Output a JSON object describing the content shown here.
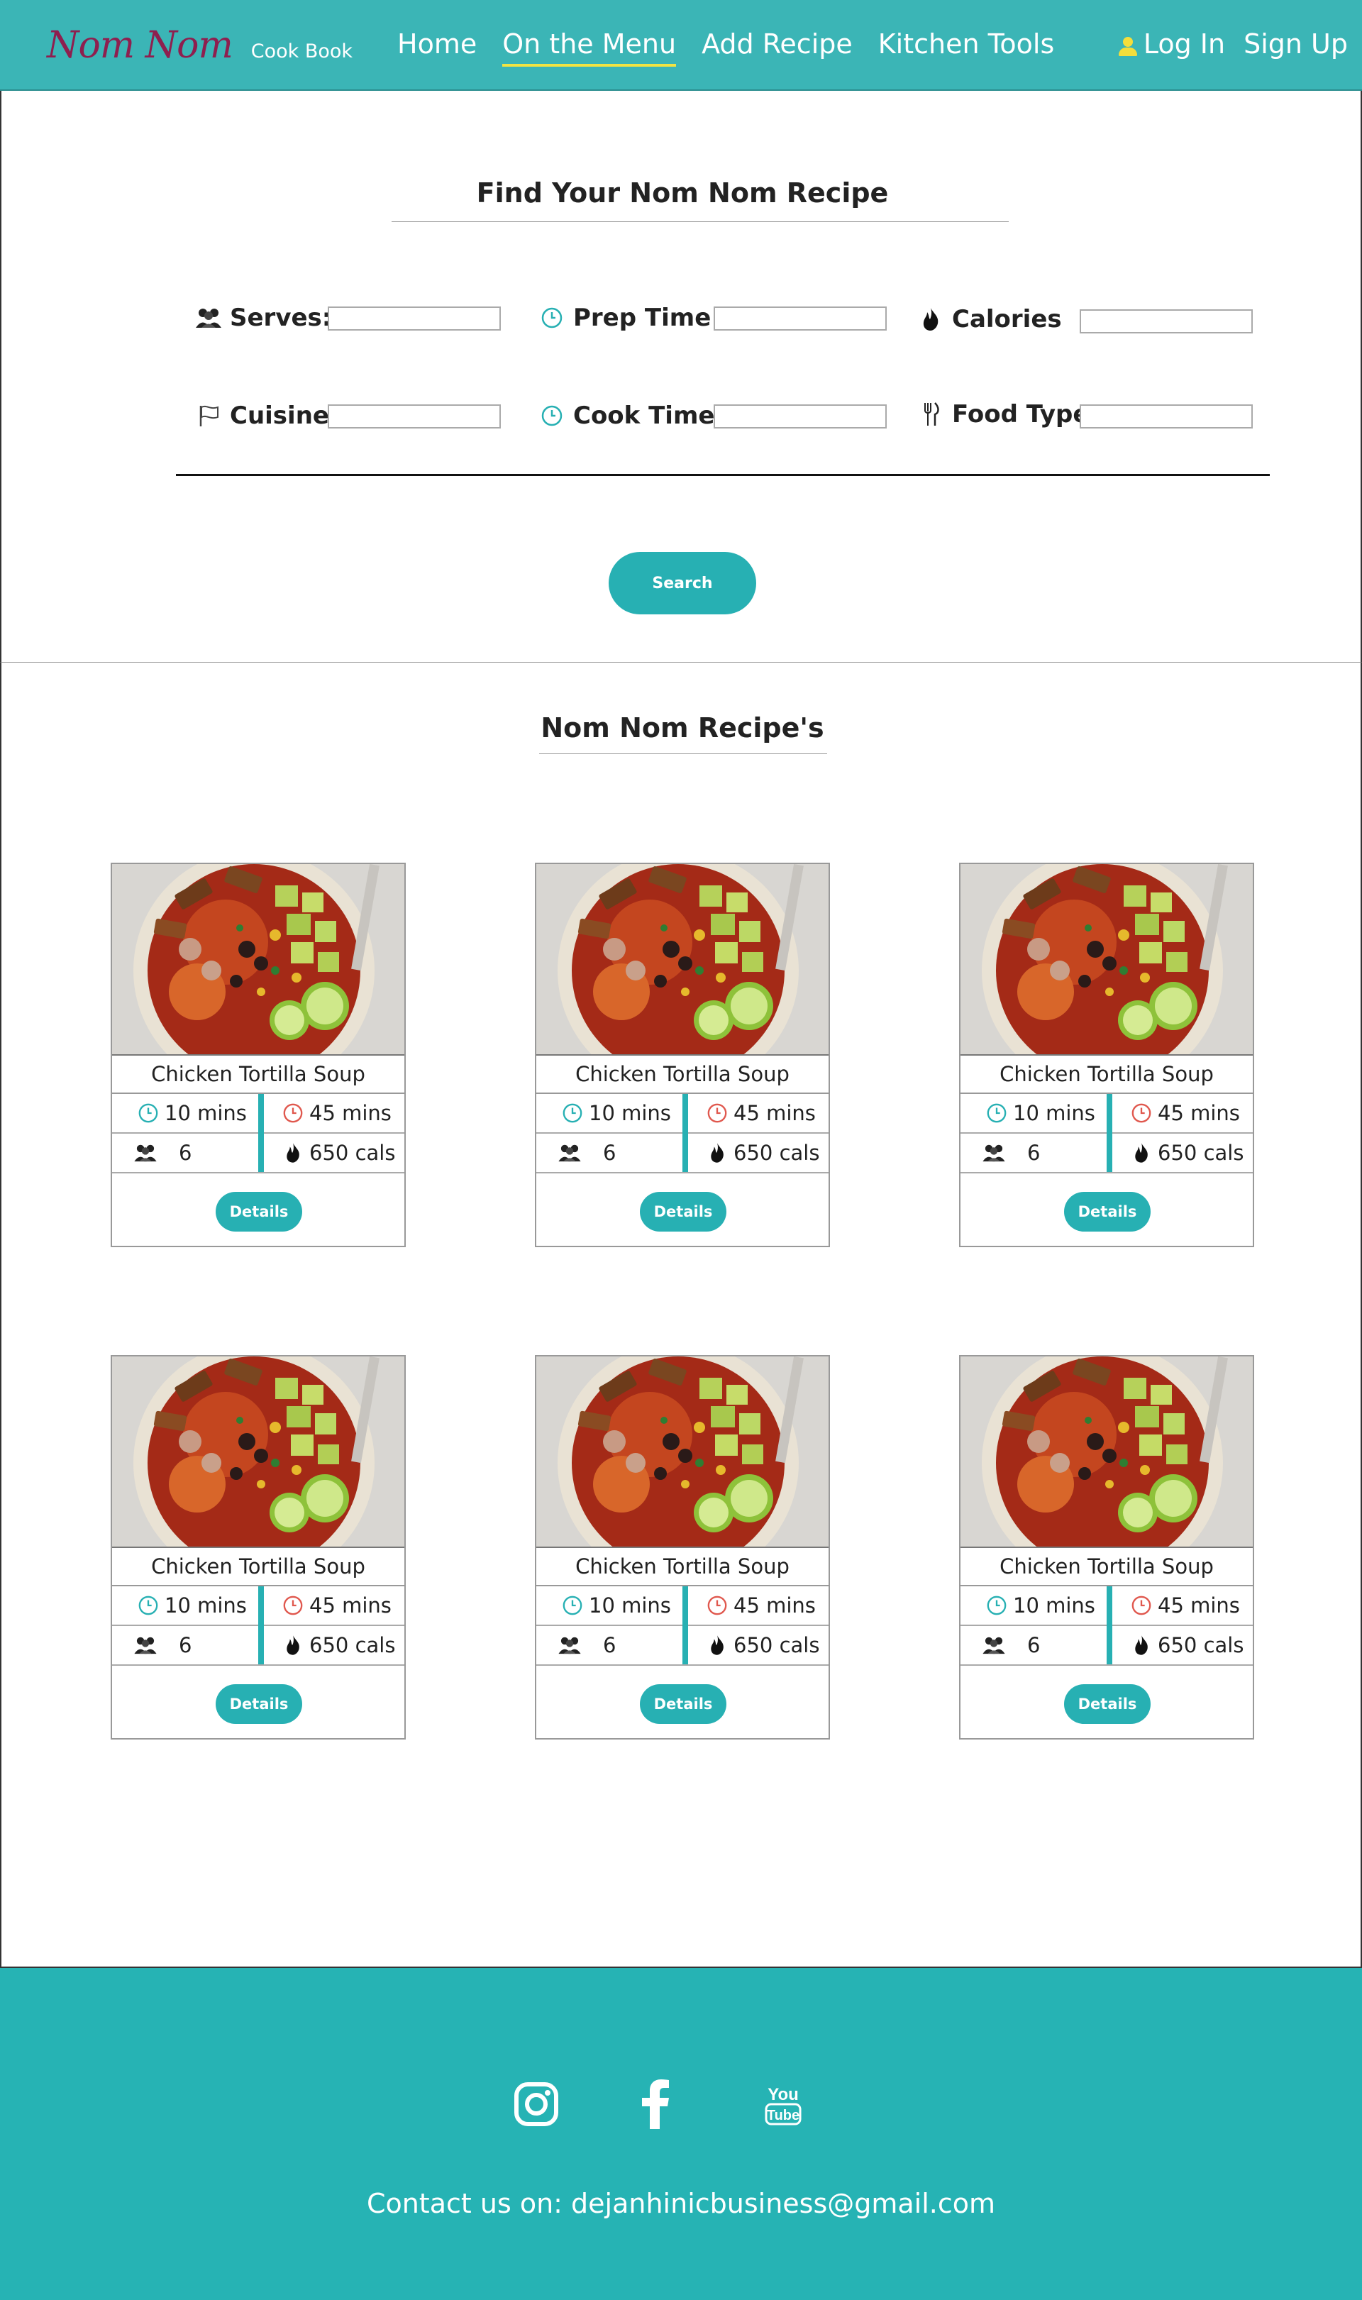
{
  "navbar": {
    "brand": "Nom Nom",
    "brand_sub": "Cook Book",
    "links": [
      {
        "label": "Home",
        "active": false
      },
      {
        "label": "On the Menu",
        "active": true
      },
      {
        "label": "Add Recipe",
        "active": false
      },
      {
        "label": "Kitchen Tools",
        "active": false
      }
    ],
    "login": "Log In",
    "signup": "Sign Up"
  },
  "search": {
    "title": "Find Your Nom Nom Recipe",
    "fields": {
      "serves": {
        "label": "Serves:",
        "value": "",
        "icon": "people-icon"
      },
      "prep_time": {
        "label": "Prep Time :",
        "value": "",
        "icon": "clock-icon"
      },
      "calories": {
        "label": "Calories   :",
        "value": "",
        "icon": "flame-icon"
      },
      "cuisine": {
        "label": "Cuisine:",
        "value": "",
        "icon": "flag-icon"
      },
      "cook_time": {
        "label": "Cook Time:",
        "value": "",
        "icon": "clock-icon"
      },
      "food_type": {
        "label": "Food Type:",
        "value": "",
        "icon": "utensils-icon"
      }
    },
    "button": "Search"
  },
  "recipes": {
    "title": "Nom Nom Recipe's",
    "cards": [
      {
        "name": "Chicken Tortilla Soup",
        "prep": "10 mins",
        "cook": "45 mins",
        "serves": "6",
        "calories": "650 cals",
        "button": "Details"
      },
      {
        "name": "Chicken Tortilla Soup",
        "prep": "10 mins",
        "cook": "45 mins",
        "serves": "6",
        "calories": "650 cals",
        "button": "Details"
      },
      {
        "name": "Chicken Tortilla Soup",
        "prep": "10 mins",
        "cook": "45 mins",
        "serves": "6",
        "calories": "650 cals",
        "button": "Details"
      },
      {
        "name": "Chicken Tortilla Soup",
        "prep": "10 mins",
        "cook": "45 mins",
        "serves": "6",
        "calories": "650 cals",
        "button": "Details"
      },
      {
        "name": "Chicken Tortilla Soup",
        "prep": "10 mins",
        "cook": "45 mins",
        "serves": "6",
        "calories": "650 cals",
        "button": "Details"
      },
      {
        "name": "Chicken Tortilla Soup",
        "prep": "10 mins",
        "cook": "45 mins",
        "serves": "6",
        "calories": "650 cals",
        "button": "Details"
      }
    ]
  },
  "footer": {
    "social": [
      "instagram-icon",
      "facebook-icon",
      "youtube-icon"
    ],
    "youtube_text_1": "You",
    "youtube_text_2": "Tube",
    "contact": "Contact us on: dejanhinicbusiness@gmail.com"
  },
  "colors": {
    "teal": "#3bb5b6",
    "button_teal": "#27b0b3",
    "brand_logo": "#8e1f4f",
    "nav_underline": "#f1e443",
    "user_icon": "#f4de3b",
    "cook_clock": "#e0584e",
    "prep_clock": "#27b0b3"
  }
}
